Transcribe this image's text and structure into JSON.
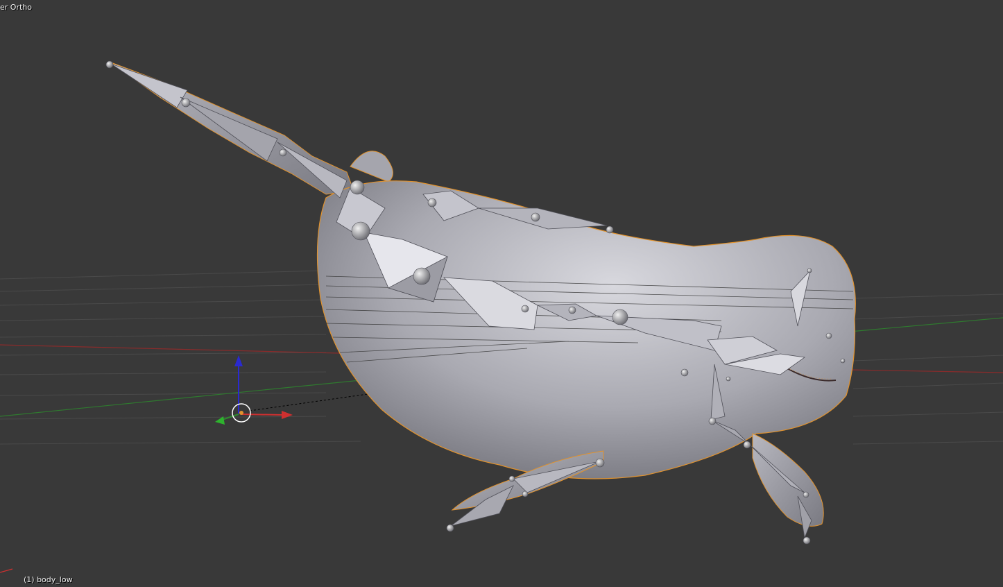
{
  "viewport": {
    "view_label": "er Ortho",
    "object_label": "(1) body_low",
    "background_color": "#393939",
    "selection_outline_color": "#e0922e",
    "axis_colors": {
      "x": "#d03030",
      "y": "#2e8b2e",
      "z": "#2a2ad0"
    }
  },
  "scene": {
    "mesh": "whale body (body_low)",
    "armature": "octahedral bones",
    "gizmo": "3d cursor / transform manipulator"
  }
}
